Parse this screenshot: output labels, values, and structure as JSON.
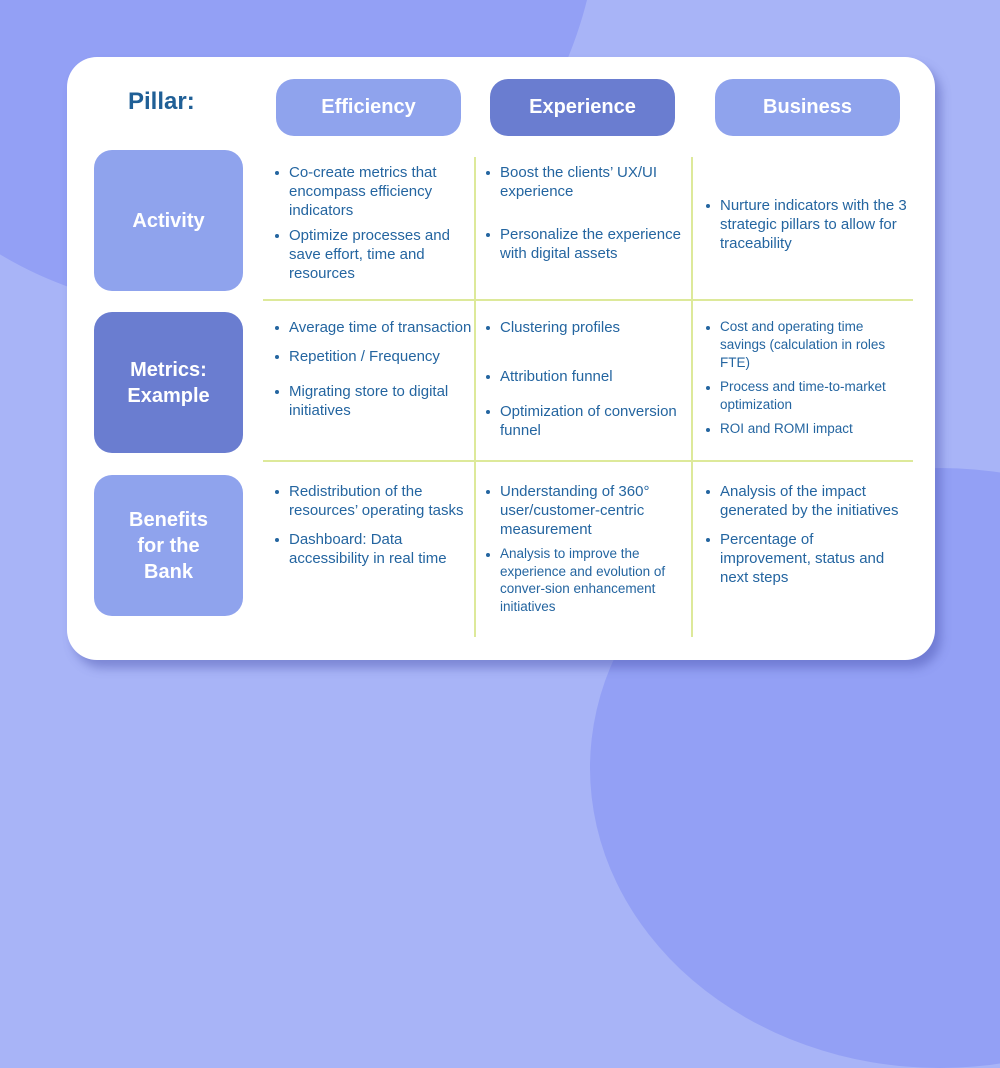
{
  "header": {
    "pillar_label": "Pillar:",
    "pillars": [
      {
        "label": "Efficiency",
        "style": "light"
      },
      {
        "label": "Experience",
        "style": "dark"
      },
      {
        "label": "Business",
        "style": "light"
      }
    ]
  },
  "rows": [
    {
      "label": "Activity",
      "cells": [
        [
          "Co-create metrics that encompass efficiency indicators",
          "Optimize processes and save effort, time and resources"
        ],
        [
          "Boost the clients’ UX/UI experience",
          "Personalize the experience with digital assets"
        ],
        [
          "Nurture indicators with the 3 strategic pillars to allow for traceability"
        ]
      ]
    },
    {
      "label": "Metrics:\nExample",
      "cells": [
        [
          "Average time of transaction",
          "Repetition / Frequency",
          "Migrating store to digital initiatives"
        ],
        [
          "Clustering profiles",
          "Attribution funnel",
          "Optimization of conversion funnel"
        ],
        [
          "Cost and operating time savings (calculation in roles FTE)",
          "Process and time-to-market optimization",
          "ROI and ROMI impact"
        ]
      ]
    },
    {
      "label": "Benefits\nfor the\nBank",
      "cells": [
        [
          "Redistribution of the resources’ operating tasks",
          "Dashboard: Data accessibility in real time"
        ],
        [
          "Understanding of 360° user/customer-centric measurement",
          "Analysis to improve the experience and evolution of conver-sion enhancement initiatives"
        ],
        [
          "Analysis of the impact generated by the initiatives",
          "Percentage of improvement, status and next steps"
        ]
      ]
    }
  ],
  "colors": {
    "background": "#a8b4f7",
    "background_blob": "#93a0f5",
    "pill_light": "#8fa3ed",
    "pill_dark": "#6a7dd0",
    "title_text": "#1f5f96",
    "body_text": "#2465a0",
    "divider": "#dde99a"
  }
}
